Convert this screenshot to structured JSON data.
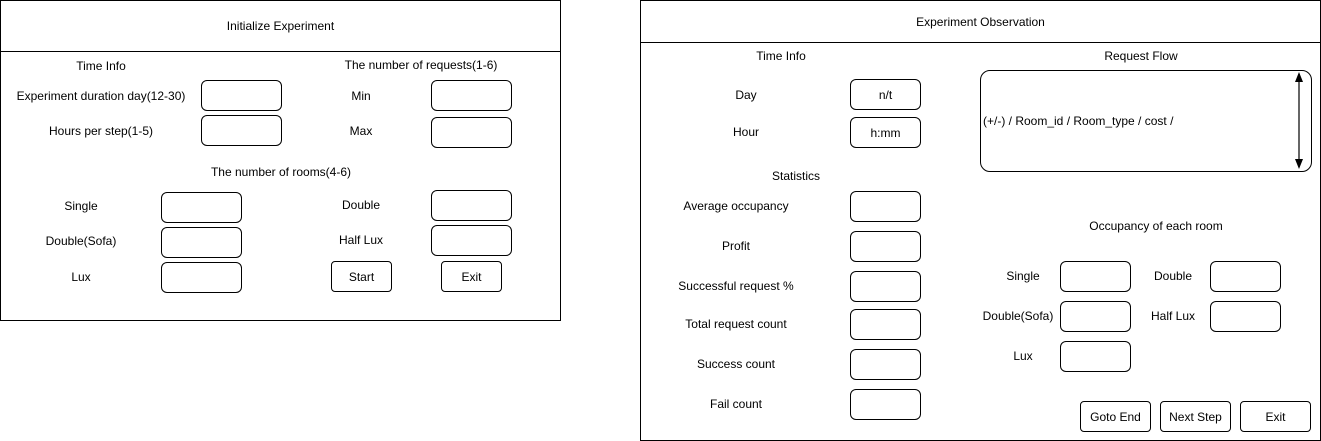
{
  "init_window": {
    "title": "Initialize Experiment",
    "time_info_heading": "Time Info",
    "duration_label": "Experiment duration day(12-30)",
    "duration_value": "",
    "hours_label": "Hours per step(1-5)",
    "hours_value": "",
    "requests_heading": "The number of requests(1-6)",
    "min_label": "Min",
    "min_value": "",
    "max_label": "Max",
    "max_value": "",
    "rooms_heading": "The number of rooms(4-6)",
    "single_label": "Single",
    "double_label": "Double",
    "double_sofa_label": "Double(Sofa)",
    "half_lux_label": "Half Lux",
    "lux_label": "Lux",
    "start_button": "Start",
    "exit_button": "Exit"
  },
  "obs_window": {
    "title": "Experiment Observation",
    "time_info_heading": "Time Info",
    "day_label": "Day",
    "day_value": "n/t",
    "hour_label": "Hour",
    "hour_value": "h:mm",
    "statistics_heading": "Statistics",
    "avg_occupancy_label": "Average occupancy",
    "profit_label": "Profit",
    "success_pct_label": "Successful request %",
    "total_requests_label": "Total request count",
    "success_count_label": "Success count",
    "fail_count_label": "Fail count",
    "request_flow_heading": "Request Flow",
    "request_flow_text": "(+/-) / Room_id / Room_type / cost /",
    "occupancy_heading": "Occupancy of each room",
    "single_label": "Single",
    "double_label": "Double",
    "double_sofa_label": "Double(Sofa)",
    "half_lux_label": "Half Lux",
    "lux_label": "Lux",
    "goto_end_button": "Goto End",
    "next_step_button": "Next Step",
    "exit_button": "Exit"
  },
  "icons": {
    "scroll_up": "arrow-up-icon",
    "scroll_down": "arrow-down-icon"
  }
}
